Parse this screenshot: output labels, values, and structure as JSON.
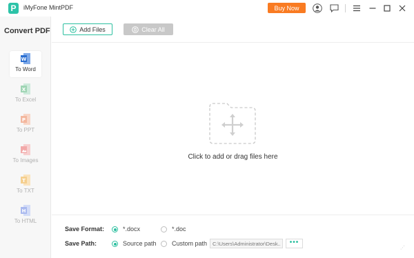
{
  "app": {
    "title": "iMyFone MintPDF",
    "logo_letter": "P",
    "buy_label": "Buy Now",
    "accent_color": "#2bbf9f",
    "buy_color": "#f97b22"
  },
  "titlebar_icons": [
    "account-icon",
    "feedback-icon",
    "menu-icon",
    "minimize-icon",
    "maximize-icon",
    "close-icon"
  ],
  "sidebar": {
    "title": "Convert PDF",
    "items": [
      {
        "label": "To Word",
        "icon": "word-icon",
        "color": "#2b6fd1",
        "active": true
      },
      {
        "label": "To Excel",
        "icon": "excel-icon",
        "color": "#9fd5b4",
        "active": false
      },
      {
        "label": "To PPT",
        "icon": "ppt-icon",
        "color": "#f3b79e",
        "active": false
      },
      {
        "label": "To Images",
        "icon": "image-icon",
        "color": "#f2a9a9",
        "active": false
      },
      {
        "label": "To TXT",
        "icon": "txt-icon",
        "color": "#f5cf8e",
        "active": false
      },
      {
        "label": "To HTML",
        "icon": "html-icon",
        "color": "#a9b9ef",
        "active": false
      }
    ]
  },
  "toolbar": {
    "add_label": "Add Files",
    "clear_label": "Clear All"
  },
  "dropzone": {
    "text": "Click to add or drag files here"
  },
  "settings": {
    "format_label": "Save Format:",
    "format_options": [
      {
        "label": "*.docx",
        "checked": true
      },
      {
        "label": "*.doc",
        "checked": false
      }
    ],
    "path_label": "Save Path:",
    "path_options": [
      {
        "label": "Source path",
        "checked": true
      },
      {
        "label": "Custom path",
        "checked": false
      }
    ],
    "custom_path_value": "C:\\Users\\Administrator\\Desk...",
    "browse_label": "•••"
  }
}
